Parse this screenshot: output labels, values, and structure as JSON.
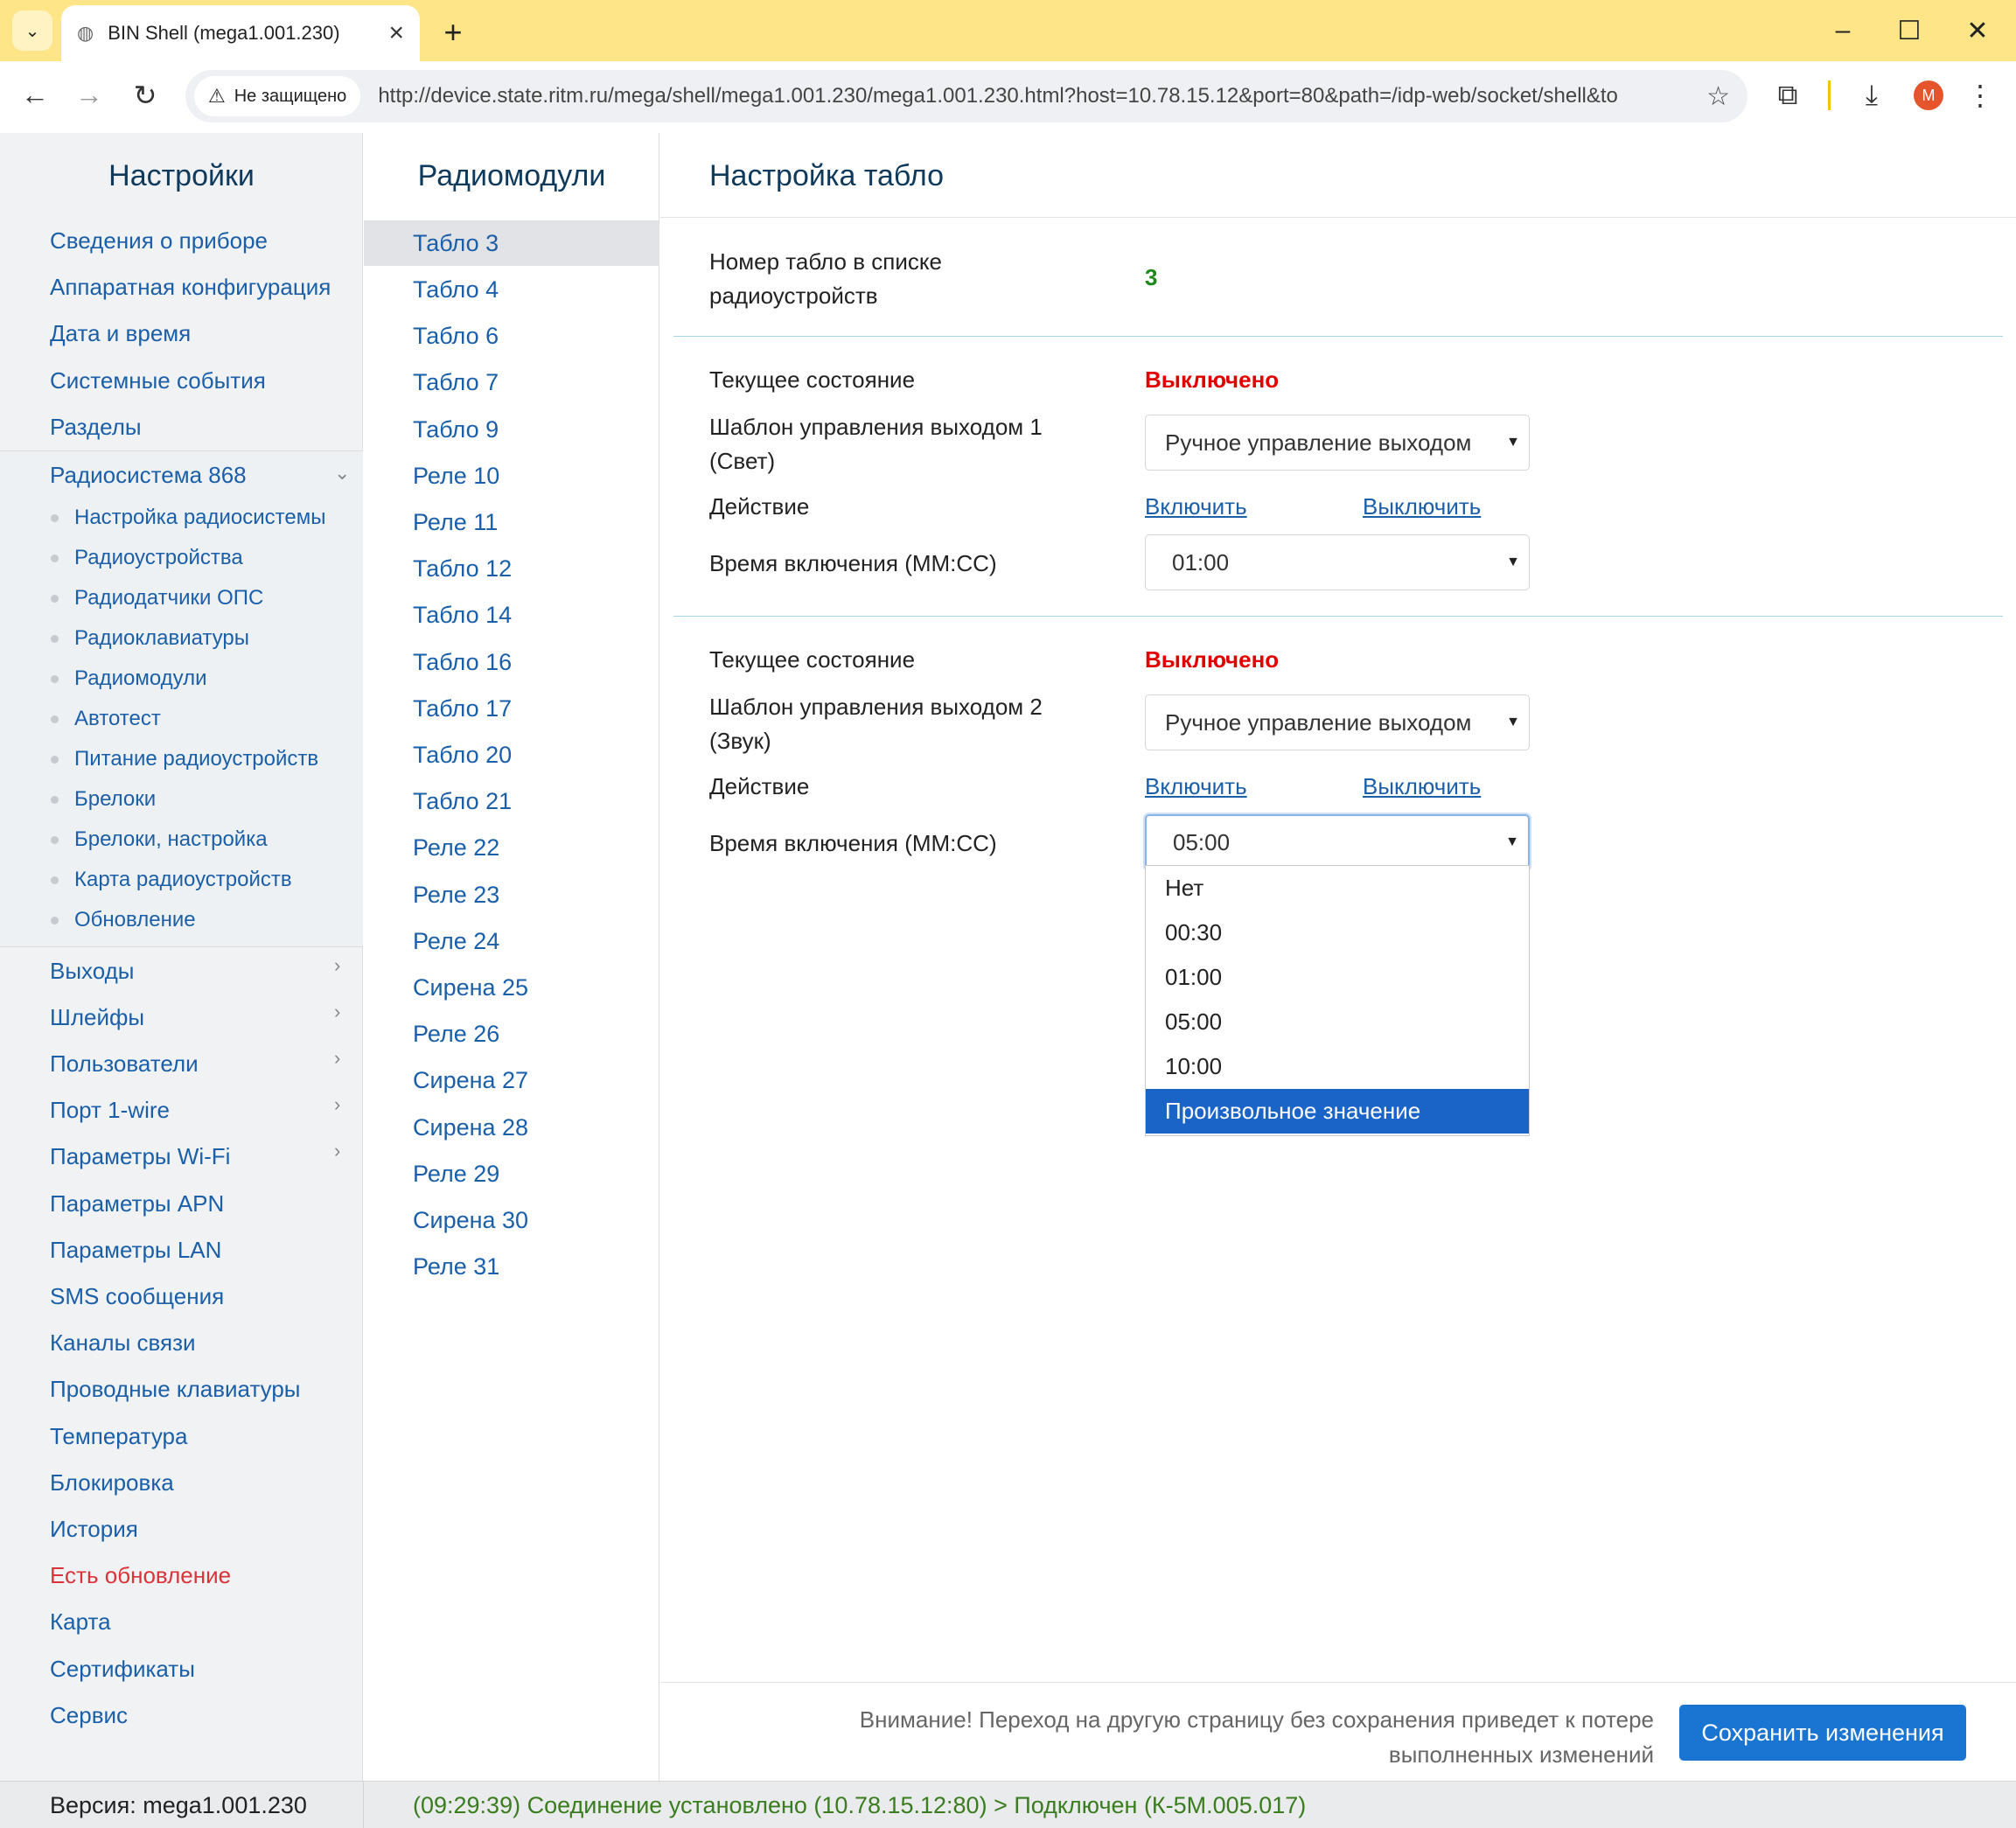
{
  "browser": {
    "tab_title": "BIN Shell (mega1.001.230)",
    "security_label": "Не защищено",
    "url": "http://device.state.ritm.ru/mega/shell/mega1.001.230/mega1.001.230.html?host=10.78.15.12&port=80&path=/idp-web/socket/shell&to...",
    "avatar_letter": "M"
  },
  "left_panel": {
    "title": "Настройки",
    "items_top": [
      "Сведения о приборе",
      "Аппаратная конфигурация",
      "Дата и время",
      "Системные события",
      "Разделы"
    ],
    "expanded": {
      "label": "Радиосистема 868",
      "subitems": [
        "Настройка радиосистемы",
        "Радиоустройства",
        "Радиодатчики ОПС",
        "Радиоклавиатуры",
        "Радиомодули",
        "Автотест",
        "Питание радиоустройств",
        "Брелоки",
        "Брелоки, настройка",
        "Карта радиоустройств",
        "Обновление"
      ]
    },
    "items_chevron": [
      "Выходы",
      "Шлейфы",
      "Пользователи",
      "Порт 1-wire",
      "Параметры Wi-Fi"
    ],
    "items_bottom": [
      "Параметры APN",
      "Параметры LAN",
      "SMS сообщения",
      "Каналы связи",
      "Проводные клавиатуры",
      "Температура",
      "Блокировка",
      "История"
    ],
    "update_item": "Есть обновление",
    "items_end": [
      "Карта",
      "Сертификаты",
      "Сервис"
    ]
  },
  "mid_panel": {
    "title": "Радиомодули",
    "items": [
      "Табло 3",
      "Табло 4",
      "Табло 6",
      "Табло 7",
      "Табло 9",
      "Реле 10",
      "Реле 11",
      "Табло 12",
      "Табло 14",
      "Табло 16",
      "Табло 17",
      "Табло 20",
      "Табло 21",
      "Реле 22",
      "Реле 23",
      "Реле 24",
      "Сирена 25",
      "Реле 26",
      "Сирена 27",
      "Сирена 28",
      "Реле 29",
      "Сирена 30",
      "Реле 31"
    ],
    "selected": "Табло 3"
  },
  "main": {
    "title": "Настройка табло",
    "number_label": "Номер табло в списке радиоустройств",
    "number_value": "3",
    "output1": {
      "state_label": "Текущее состояние",
      "state_value": "Выключено",
      "template_label": "Шаблон управления выходом 1 (Свет)",
      "template_value": "Ручное управление выходом",
      "action_label": "Действие",
      "action_on": "Включить",
      "action_off": "Выключить",
      "time_label": "Время включения (ММ:СС)",
      "time_value": "01:00"
    },
    "output2": {
      "state_label": "Текущее состояние",
      "state_value": "Выключено",
      "template_label": "Шаблон управления выходом 2 (Звук)",
      "template_value": "Ручное управление выходом",
      "action_label": "Действие",
      "action_on": "Включить",
      "action_off": "Выключить",
      "time_label": "Время включения (ММ:СС)",
      "time_value": "05:00",
      "time_options": [
        "Нет",
        "00:30",
        "01:00",
        "05:00",
        "10:00",
        "Произвольное значение"
      ],
      "highlighted_option": "Произвольное значение"
    }
  },
  "footer": {
    "warning": "Внимание! Переход на другую страницу без сохранения приведет к потере выполненных изменений",
    "save_label": "Сохранить изменения"
  },
  "status": {
    "version": "Версия: mega1.001.230",
    "connection": "(09:29:39) Соединение установлено (10.78.15.12:80) > Подключен (К-5М.005.017)"
  },
  "colors": {
    "accent": "#1a75d2",
    "link": "#1a5fa8",
    "state_off": "#e00000",
    "number": "#1e8a1e",
    "update": "#d9343a",
    "highlight": "#1a64c8"
  }
}
